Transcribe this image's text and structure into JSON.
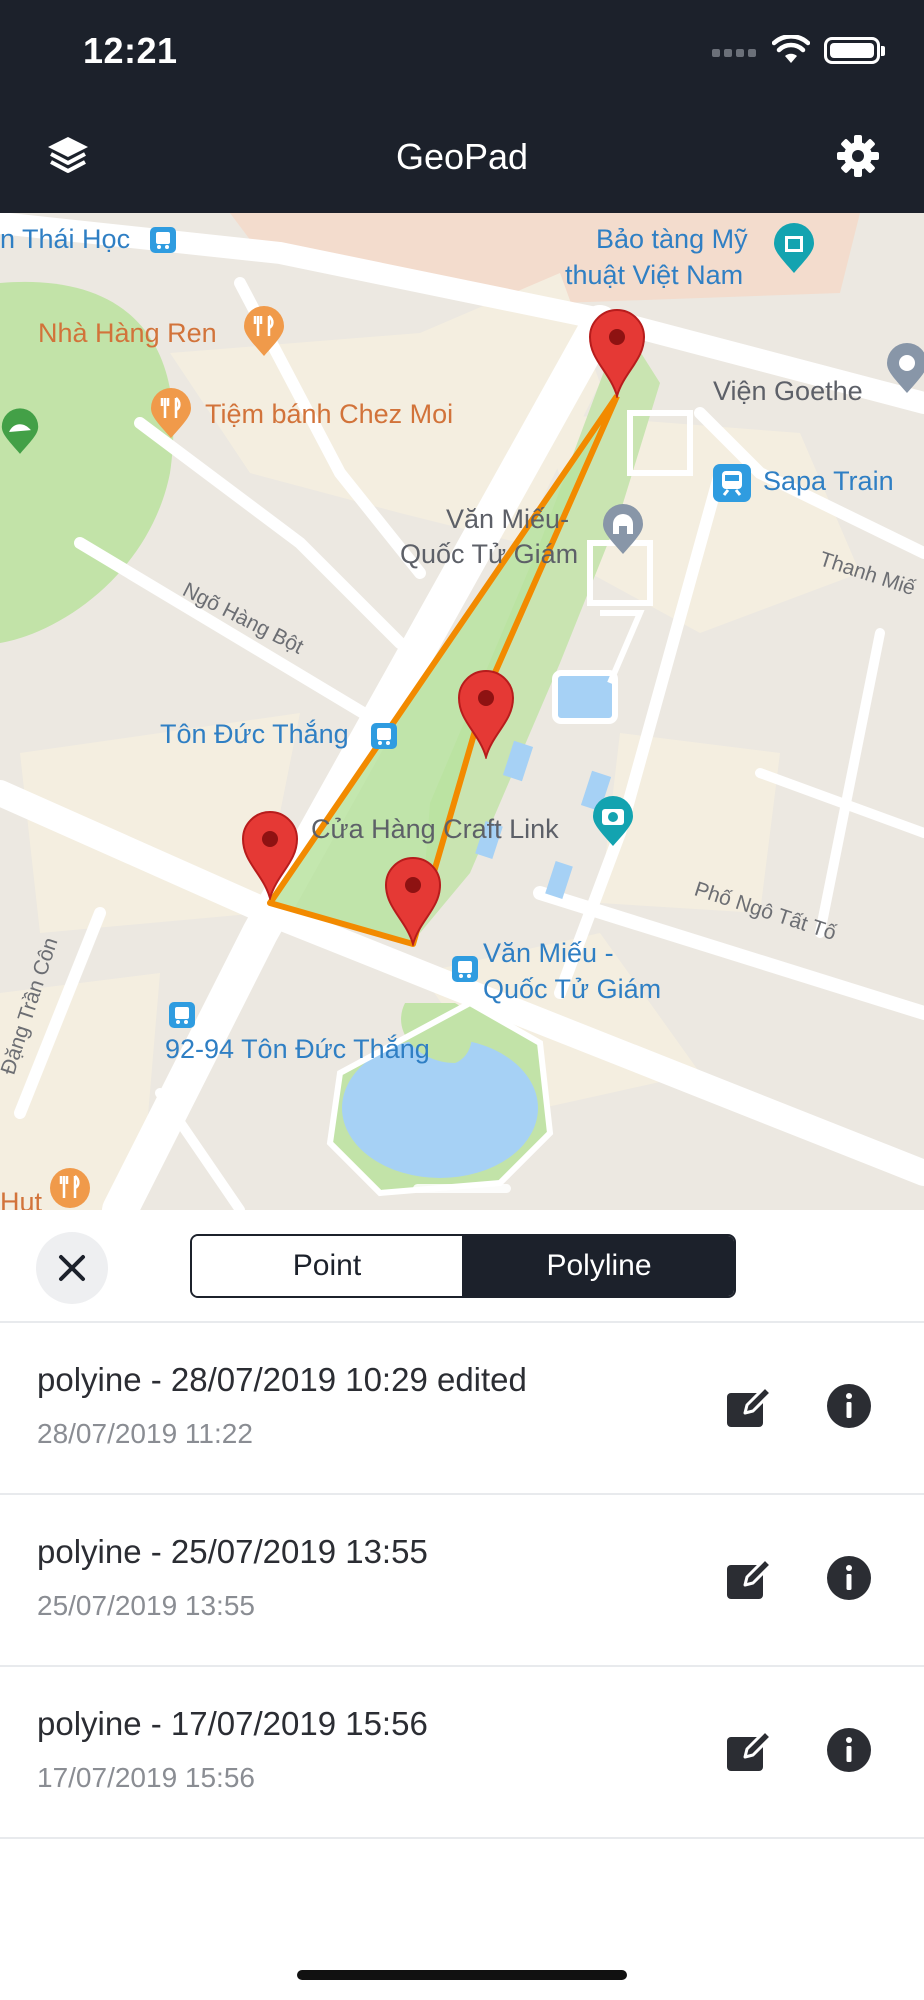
{
  "status_bar": {
    "time": "12:21"
  },
  "header": {
    "title": "GeoPad"
  },
  "icons": {
    "layers": "layers-icon",
    "settings": "gear-icon",
    "close": "close-icon",
    "edit": "edit-icon",
    "info": "info-icon"
  },
  "map": {
    "labels": {
      "thai_hoc": "n Thái Học",
      "bao_tang_1": "Bảo tàng Mỹ",
      "bao_tang_2": "thuật Việt Nam",
      "nha_hang": "Nhà Hàng Ren",
      "vien_goethe": "Viện Goethe",
      "tiem_banh": "Tiệm bánh Chez Moi",
      "sapa_train": "Sapa Train",
      "van_mieu_1": "Văn Miếu-",
      "van_mieu_2": "Quốc Tử Giám",
      "thanh_mien": "Thanh Miế",
      "ngo_hang_bot": "Ngõ Hàng Bột",
      "ton_duc_thang": "Tôn Đức Thắng",
      "craft_link": "Cửa Hàng Craft Link",
      "pho_ngo_tat_to": "Phố Ngô Tất Tố",
      "van_mieu_stop_1": "Văn Miếu -",
      "van_mieu_stop_2": "Quốc Tử Giám",
      "dang_tran_con": "Đặng Trần Côn",
      "ton_duc_thang_9294": "92-94 Tôn Đức Thắng",
      "hut": "Hut"
    },
    "colors": {
      "polyline": "#f28a00",
      "polygon_fill": "#b8e3a0",
      "marker": "#e53935",
      "park": "#c2e3a8",
      "water": "#a6d1f5"
    }
  },
  "segmented": {
    "point_label": "Point",
    "polyline_label": "Polyline",
    "selected": "Polyline"
  },
  "items": [
    {
      "title": "polyine - 28/07/2019 10:29 edited",
      "date": "28/07/2019 11:22"
    },
    {
      "title": "polyine - 25/07/2019 13:55",
      "date": "25/07/2019 13:55"
    },
    {
      "title": "polyine - 17/07/2019 15:56",
      "date": "17/07/2019 15:56"
    }
  ]
}
